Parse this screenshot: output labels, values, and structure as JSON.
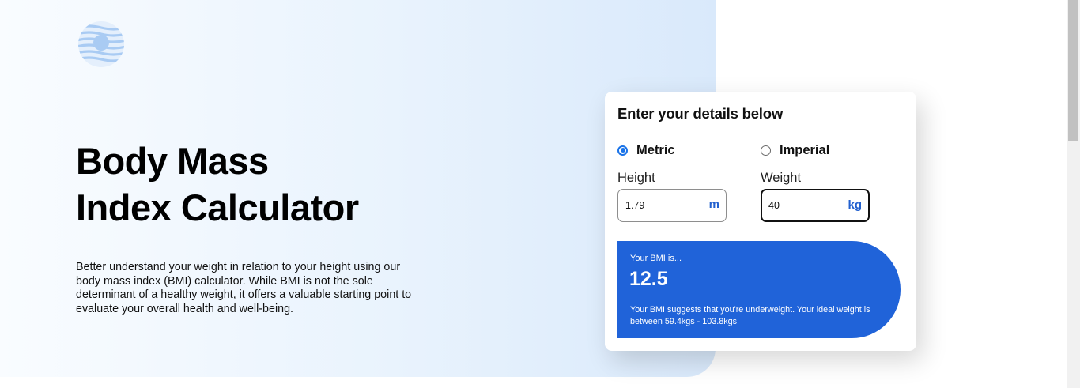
{
  "header": {
    "logo_icon": "bmi-logo-icon"
  },
  "hero": {
    "title_line1": "Body Mass",
    "title_line2": "Index Calculator",
    "description": "Better understand your weight in relation to your height using our body mass index (BMI) calculator. While BMI is not the sole determinant of a healthy weight, it offers a valuable starting point to evaluate your overall health and well-being."
  },
  "calculator": {
    "title": "Enter your details below",
    "units": {
      "metric_label": "Metric",
      "imperial_label": "Imperial",
      "selected": "Metric"
    },
    "height": {
      "label": "Height",
      "value": "1.79",
      "unit": "m"
    },
    "weight": {
      "label": "Weight",
      "value": "40",
      "unit": "kg"
    },
    "result": {
      "label": "Your BMI is...",
      "value": "12.5",
      "message": "Your BMI suggests that you're underweight. Your ideal weight is between 59.4kgs - 103.8kgs"
    }
  },
  "colors": {
    "accent": "#2063d9",
    "radio_selected": "#1a73e8"
  }
}
